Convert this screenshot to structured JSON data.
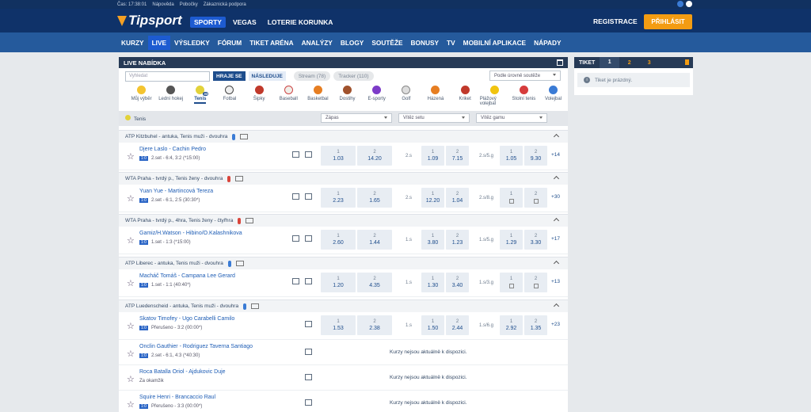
{
  "util": {
    "time": "Čas: 17:38:01",
    "links": [
      "Nápověda",
      "Pobočky",
      "Zákaznická podpora"
    ]
  },
  "header": {
    "logo": "Tipsport",
    "nav": [
      "SPORTY",
      "VEGAS",
      "LOTERIE KORUNKA"
    ],
    "register": "REGISTRACE",
    "login": "PŘIHLÁSIT"
  },
  "mainnav": [
    "KURZY",
    "LIVE",
    "VÝSLEDKY",
    "FÓRUM",
    "TIKET ARÉNA",
    "ANALÝZY",
    "BLOGY",
    "SOUTĚŽE",
    "BONUSY",
    "TV",
    "MOBILNÍ APLIKACE",
    "NÁPADY"
  ],
  "live": {
    "title": "LIVE NABÍDKA",
    "search_placeholder": "Vyhledat",
    "btn_play": "HRAJE SE",
    "btn_next": "NÁSLEDUJE",
    "stream": "Stream (78)",
    "tracker": "Tracker (110)",
    "sort": "Podle úrovně soutěže",
    "sports": [
      "Můj výběr",
      "Lední hokej",
      "Tenis",
      "Fotbal",
      "Šipky",
      "Baseball",
      "Basketbal",
      "Dostihy",
      "E-sporty",
      "Golf",
      "Házená",
      "Kriket",
      "Plážový volejbal",
      "Stolní tenis",
      "Volejbal"
    ],
    "tennis_count": "33",
    "subfilter": {
      "sport": "Tenis",
      "sel1": "Zápas",
      "sel2": "Vítěz setu",
      "sel3": "Vítěz gamu"
    }
  },
  "leagues": [
    {
      "name": "ATP Kitzbuhel - antuka, Tenis muži - dvouhra"
    },
    {
      "name": "WTA Praha - tvrdý p., Tenis ženy - dvouhra"
    },
    {
      "name": "WTA Praha - tvrdý p., 4hra, Tenis ženy - čtyřhra"
    },
    {
      "name": "ATP Liberec - antuka, Tenis muži - dvouhra"
    },
    {
      "name": "ATP Luedenscheid - antuka, Tenis muži - dvouhra"
    }
  ],
  "matches": [
    {
      "name": "Djere Laslo - Cachin Pedro",
      "score": "2.set - 6:4, 3:2 (*15:00)",
      "o1": "1.03",
      "o2": "14.20",
      "l2": "2.s",
      "s1": "1.09",
      "s2": "7.15",
      "l3": "2.s/5.g",
      "g1": "1.05",
      "g2": "9.30",
      "more": "+14"
    },
    {
      "name": "Yuan Yue - Martincová Tereza",
      "score": "2.set - 6:1, 2:5 (30:30*)",
      "o1": "2.23",
      "o2": "1.65",
      "l2": "2.s",
      "s1": "12.20",
      "s2": "1.04",
      "l3": "2.s/8.g",
      "g1": "",
      "g2": "",
      "more": "+30"
    },
    {
      "name": "Gamiz/H.Watson - Hibino/O.Kalashnikova",
      "score": "1.set - 1:3 (*15:00)",
      "o1": "2.60",
      "o2": "1.44",
      "l2": "1.s",
      "s1": "3.80",
      "s2": "1.23",
      "l3": "1.s/5.g",
      "g1": "1.29",
      "g2": "3.30",
      "more": "+17"
    },
    {
      "name": "Macháč Tomáš - Campana Lee Gerard",
      "score": "1.set - 1:1 (40:40*)",
      "o1": "1.20",
      "o2": "4.35",
      "l2": "1.s",
      "s1": "1.30",
      "s2": "3.40",
      "l3": "1.s/3.g",
      "g1": "",
      "g2": "",
      "more": "+13"
    },
    {
      "name": "Skatov Timofey - Ugo Carabelli Camilo",
      "score": "Přerušeno - 3:2 (00:00*)",
      "o1": "1.53",
      "o2": "2.38",
      "l2": "1.s",
      "s1": "1.50",
      "s2": "2.44",
      "l3": "1.s/6.g",
      "g1": "2.92",
      "g2": "1.35",
      "more": "+23"
    },
    {
      "name": "Onclin Gauthier - Rodriguez Taverna Santiago",
      "score": "2.set - 6:1, 4:3 (*40:30)",
      "unavail": "Kurzy nejsou aktuálně k dispozici."
    },
    {
      "name": "Roca Batalla Oriol - Ajdukovic Duje",
      "score": "Za okamžik",
      "unavail": "Kurzy nejsou aktuálně k dispozici."
    },
    {
      "name": "Squire Henri - Brancaccio Raul",
      "score": "Přerušeno - 3:3 (00:00*)",
      "unavail": "Kurzy nejsou aktuálně k dispozici."
    }
  ],
  "odd_headers": {
    "one": "1",
    "two": "2"
  },
  "ticket": {
    "title": "TIKET",
    "tabs": [
      "1",
      "2",
      "3"
    ],
    "empty": "Tiket je prázdný."
  }
}
